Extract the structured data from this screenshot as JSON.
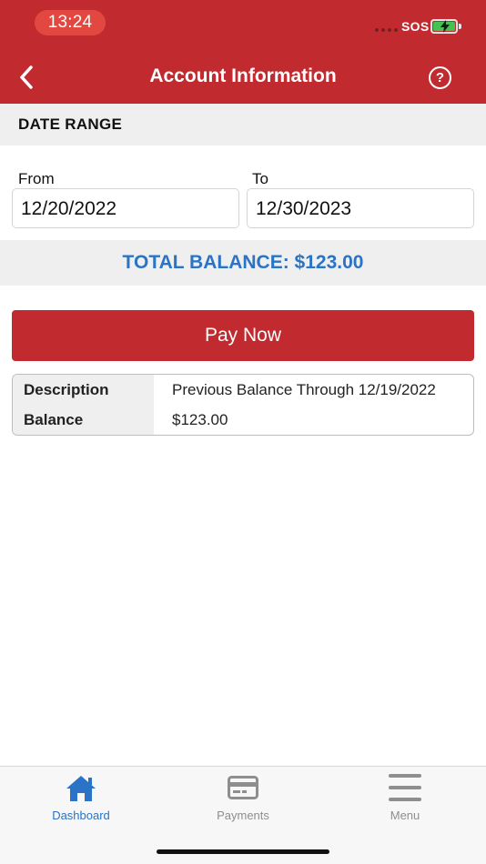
{
  "status_bar": {
    "time": "13:24",
    "carrier": "SOS"
  },
  "nav": {
    "title": "Account Information",
    "help_symbol": "?"
  },
  "date_range": {
    "title": "DATE RANGE",
    "from_label": "From",
    "from_value": "12/20/2022",
    "to_label": "To",
    "to_value": "12/30/2023"
  },
  "total_balance": "TOTAL BALANCE: $123.00",
  "pay_button_label": "Pay Now",
  "details": [
    {
      "label": "Description",
      "value": "Previous Balance Through 12/19/2022"
    },
    {
      "label": "Balance",
      "value": "$123.00"
    }
  ],
  "tabs": [
    {
      "label": "Dashboard",
      "icon": "home-icon",
      "active": true
    },
    {
      "label": "Payments",
      "icon": "credit-card-icon",
      "active": false
    },
    {
      "label": "Menu",
      "icon": "hamburger-menu-icon",
      "active": false
    }
  ],
  "colors": {
    "brand_red": "#c12b2f",
    "accent_blue": "#2a73c6",
    "inactive_gray": "#8e8e8e"
  }
}
